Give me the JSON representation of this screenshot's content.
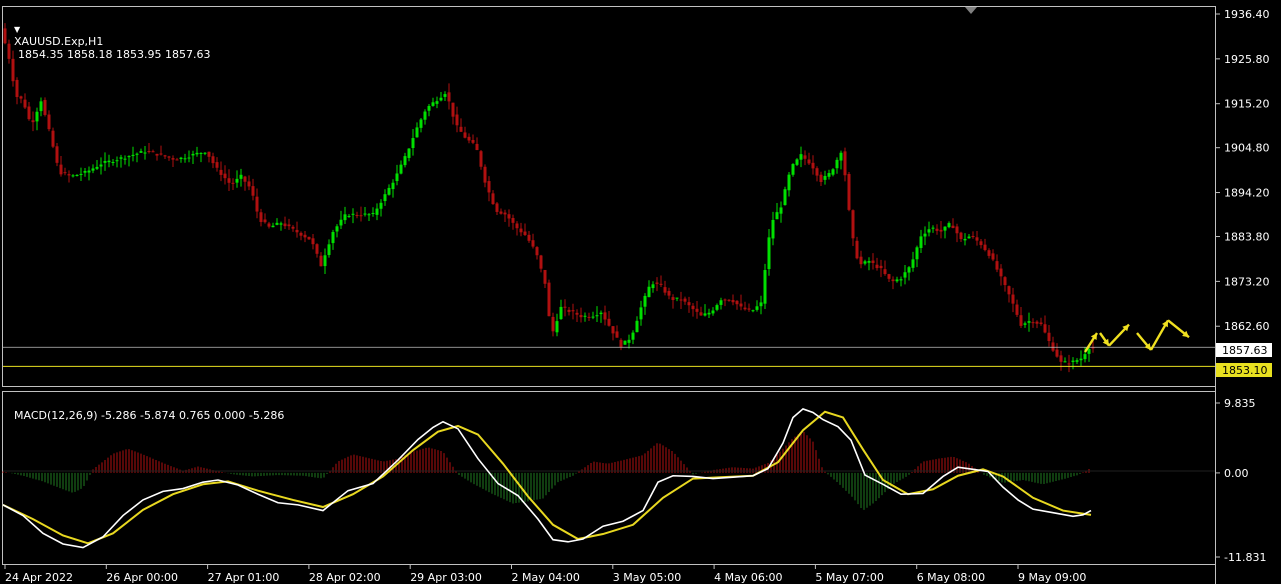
{
  "header": {
    "symbol": "XAUUSD.Exp,H1",
    "ohlc": "1854.35 1858.18 1853.95 1857.63"
  },
  "macd_header": {
    "label": "MACD(12,26,9) -5.286 -5.874 0.765 0.000 -5.286"
  },
  "colors": {
    "background": "#000000",
    "bull": "#00e000",
    "bear": "#b01010",
    "axis": "#c0c0c0",
    "macd_line": "#ffffff",
    "signal_line": "#e8d820",
    "price_line": "#c0c0c0",
    "level_line": "#e8e020",
    "arrow": "#f0e020"
  },
  "chart_data": [
    {
      "type": "candlestick",
      "title": "XAUUSD.Exp,H1",
      "ylim": [
        1850.6,
        1936.4
      ],
      "y_ticks": [
        "1936.40",
        "1925.80",
        "1915.20",
        "1904.80",
        "1894.20",
        "1883.80",
        "1873.20",
        "1862.60"
      ],
      "x_ticks": [
        "24 Apr 2022",
        "26 Apr 00:00",
        "27 Apr 01:00",
        "28 Apr 02:00",
        "29 Apr 03:00",
        "2 May 04:00",
        "3 May 05:00",
        "4 May 06:00",
        "5 May 07:00",
        "6 May 08:00",
        "9 May 09:00"
      ],
      "current_price": 1857.63,
      "current_price_label": "1857.63",
      "level": 1853.1,
      "level_label": "1853.10",
      "price_path": [
        [
          0,
          1933
        ],
        [
          8,
          1926
        ],
        [
          15,
          1917
        ],
        [
          22,
          1916
        ],
        [
          30,
          1910
        ],
        [
          40,
          1916
        ],
        [
          50,
          1907
        ],
        [
          58,
          1899
        ],
        [
          70,
          1898
        ],
        [
          85,
          1899
        ],
        [
          100,
          1901
        ],
        [
          115,
          1902
        ],
        [
          130,
          1903
        ],
        [
          145,
          1904
        ],
        [
          160,
          1903
        ],
        [
          175,
          1902
        ],
        [
          190,
          1903
        ],
        [
          205,
          1904
        ],
        [
          215,
          1900
        ],
        [
          230,
          1896
        ],
        [
          240,
          1898
        ],
        [
          250,
          1895
        ],
        [
          258,
          1888
        ],
        [
          268,
          1886
        ],
        [
          280,
          1887
        ],
        [
          295,
          1885
        ],
        [
          310,
          1883
        ],
        [
          320,
          1877
        ],
        [
          332,
          1885
        ],
        [
          345,
          1889
        ],
        [
          360,
          1889
        ],
        [
          372,
          1889
        ],
        [
          385,
          1894
        ],
        [
          395,
          1898
        ],
        [
          405,
          1903
        ],
        [
          415,
          1909
        ],
        [
          425,
          1914
        ],
        [
          435,
          1916
        ],
        [
          445,
          1918
        ],
        [
          455,
          1910
        ],
        [
          465,
          1907
        ],
        [
          475,
          1905
        ],
        [
          485,
          1896
        ],
        [
          495,
          1890
        ],
        [
          505,
          1889
        ],
        [
          515,
          1886
        ],
        [
          525,
          1884
        ],
        [
          535,
          1880
        ],
        [
          545,
          1872
        ],
        [
          550,
          1860
        ],
        [
          560,
          1867
        ],
        [
          570,
          1866
        ],
        [
          580,
          1865
        ],
        [
          590,
          1865
        ],
        [
          600,
          1866
        ],
        [
          610,
          1862
        ],
        [
          620,
          1858
        ],
        [
          630,
          1860
        ],
        [
          640,
          1867
        ],
        [
          650,
          1873
        ],
        [
          660,
          1872
        ],
        [
          670,
          1869
        ],
        [
          680,
          1869
        ],
        [
          690,
          1867
        ],
        [
          700,
          1865
        ],
        [
          710,
          1866
        ],
        [
          720,
          1869
        ],
        [
          730,
          1869
        ],
        [
          740,
          1867
        ],
        [
          750,
          1866
        ],
        [
          760,
          1868
        ],
        [
          765,
          1878
        ],
        [
          770,
          1887
        ],
        [
          780,
          1891
        ],
        [
          790,
          1900
        ],
        [
          800,
          1903
        ],
        [
          810,
          1901
        ],
        [
          820,
          1897
        ],
        [
          830,
          1899
        ],
        [
          840,
          1904
        ],
        [
          845,
          1897
        ],
        [
          850,
          1885
        ],
        [
          858,
          1877
        ],
        [
          868,
          1878
        ],
        [
          880,
          1876
        ],
        [
          890,
          1873
        ],
        [
          900,
          1874
        ],
        [
          910,
          1877
        ],
        [
          920,
          1884
        ],
        [
          930,
          1886
        ],
        [
          940,
          1885
        ],
        [
          950,
          1887
        ],
        [
          960,
          1883
        ],
        [
          970,
          1884
        ],
        [
          980,
          1882
        ],
        [
          990,
          1879
        ],
        [
          1000,
          1874
        ],
        [
          1010,
          1869
        ],
        [
          1020,
          1863
        ],
        [
          1030,
          1864
        ],
        [
          1040,
          1863
        ],
        [
          1050,
          1858
        ],
        [
          1060,
          1854
        ],
        [
          1070,
          1854
        ],
        [
          1080,
          1855
        ],
        [
          1088,
          1857.6
        ]
      ],
      "forecast_arrows": [
        [
          [
            1082,
            1856.5
          ],
          [
            1094,
            1861
          ]
        ],
        [
          [
            1097,
            1861
          ],
          [
            1106,
            1858
          ]
        ],
        [
          [
            1106,
            1858
          ],
          [
            1126,
            1863
          ]
        ],
        [
          [
            1134,
            1861
          ],
          [
            1148,
            1857
          ]
        ],
        [
          [
            1148,
            1857
          ],
          [
            1165,
            1864
          ]
        ],
        [
          [
            1165,
            1864
          ],
          [
            1186,
            1860
          ]
        ]
      ]
    },
    {
      "type": "line",
      "title": "MACD(12,26,9)",
      "ylim": [
        -11.831,
        9.835
      ],
      "y_ticks": [
        "9.835",
        "0.00",
        "-11.831"
      ],
      "values_label": "-5.286 -5.874 0.765 0.000 -5.286",
      "macd": [
        [
          0,
          -4.5
        ],
        [
          20,
          -6
        ],
        [
          40,
          -8.5
        ],
        [
          60,
          -10
        ],
        [
          80,
          -10.5
        ],
        [
          100,
          -9
        ],
        [
          120,
          -6
        ],
        [
          140,
          -3.8
        ],
        [
          160,
          -2.6
        ],
        [
          180,
          -2.2
        ],
        [
          200,
          -1.3
        ],
        [
          215,
          -1.0
        ],
        [
          235,
          -1.7
        ],
        [
          255,
          -3
        ],
        [
          275,
          -4.2
        ],
        [
          295,
          -4.5
        ],
        [
          320,
          -5.3
        ],
        [
          345,
          -2.5
        ],
        [
          370,
          -1.5
        ],
        [
          395,
          1.8
        ],
        [
          415,
          4.7
        ],
        [
          430,
          6.4
        ],
        [
          440,
          7.2
        ],
        [
          455,
          6.2
        ],
        [
          475,
          2.0
        ],
        [
          495,
          -1.5
        ],
        [
          515,
          -3.2
        ],
        [
          535,
          -6.5
        ],
        [
          550,
          -9.4
        ],
        [
          565,
          -9.7
        ],
        [
          580,
          -9.3
        ],
        [
          600,
          -7.5
        ],
        [
          620,
          -6.8
        ],
        [
          640,
          -5.3
        ],
        [
          655,
          -1.3
        ],
        [
          670,
          -0.4
        ],
        [
          690,
          -0.5
        ],
        [
          710,
          -0.8
        ],
        [
          730,
          -0.6
        ],
        [
          750,
          -0.4
        ],
        [
          765,
          0.6
        ],
        [
          780,
          4.2
        ],
        [
          790,
          7.8
        ],
        [
          800,
          9.0
        ],
        [
          810,
          8.5
        ],
        [
          820,
          7.5
        ],
        [
          835,
          6.5
        ],
        [
          848,
          4.6
        ],
        [
          862,
          -0.3
        ],
        [
          880,
          -1.6
        ],
        [
          898,
          -3.0
        ],
        [
          920,
          -2.9
        ],
        [
          940,
          -0.5
        ],
        [
          955,
          0.8
        ],
        [
          970,
          0.5
        ],
        [
          985,
          0.2
        ],
        [
          1000,
          -2.0
        ],
        [
          1015,
          -3.8
        ],
        [
          1030,
          -5.1
        ],
        [
          1050,
          -5.6
        ],
        [
          1070,
          -6.1
        ],
        [
          1080,
          -5.9
        ],
        [
          1088,
          -5.3
        ]
      ],
      "signal": [
        [
          0,
          -4.5
        ],
        [
          30,
          -6.5
        ],
        [
          60,
          -8.8
        ],
        [
          85,
          -9.9
        ],
        [
          110,
          -8.5
        ],
        [
          140,
          -5.2
        ],
        [
          170,
          -3
        ],
        [
          200,
          -1.6
        ],
        [
          225,
          -1.2
        ],
        [
          255,
          -2.5
        ],
        [
          290,
          -3.8
        ],
        [
          320,
          -4.8
        ],
        [
          350,
          -3
        ],
        [
          380,
          -0.5
        ],
        [
          410,
          3.2
        ],
        [
          435,
          5.8
        ],
        [
          455,
          6.6
        ],
        [
          475,
          5.4
        ],
        [
          500,
          1.3
        ],
        [
          525,
          -3.3
        ],
        [
          550,
          -7.3
        ],
        [
          575,
          -9.3
        ],
        [
          600,
          -8.6
        ],
        [
          630,
          -7.3
        ],
        [
          660,
          -3.5
        ],
        [
          690,
          -0.8
        ],
        [
          720,
          -0.6
        ],
        [
          750,
          -0.4
        ],
        [
          775,
          1.5
        ],
        [
          800,
          6.0
        ],
        [
          822,
          8.6
        ],
        [
          840,
          7.8
        ],
        [
          860,
          3.3
        ],
        [
          880,
          -1.0
        ],
        [
          905,
          -3.0
        ],
        [
          930,
          -2.3
        ],
        [
          955,
          -0.4
        ],
        [
          980,
          0.5
        ],
        [
          1000,
          -0.5
        ],
        [
          1030,
          -3.5
        ],
        [
          1060,
          -5.3
        ],
        [
          1088,
          -5.9
        ]
      ],
      "histogram": [
        [
          0,
          0.2
        ],
        [
          20,
          -0.4
        ],
        [
          40,
          -1.2
        ],
        [
          60,
          -2.3
        ],
        [
          70,
          -2.8
        ],
        [
          80,
          -2.1
        ],
        [
          90,
          0.5
        ],
        [
          110,
          2.7
        ],
        [
          125,
          3.4
        ],
        [
          140,
          2.6
        ],
        [
          160,
          1.4
        ],
        [
          180,
          0.3
        ],
        [
          195,
          0.9
        ],
        [
          210,
          0.4
        ],
        [
          230,
          -0.2
        ],
        [
          250,
          -0.5
        ],
        [
          275,
          -0.3
        ],
        [
          300,
          -0.4
        ],
        [
          320,
          -0.8
        ],
        [
          335,
          1.6
        ],
        [
          350,
          2.6
        ],
        [
          365,
          2.1
        ],
        [
          380,
          1.6
        ],
        [
          395,
          2.0
        ],
        [
          410,
          3.0
        ],
        [
          425,
          3.6
        ],
        [
          440,
          3.0
        ],
        [
          455,
          -0.2
        ],
        [
          470,
          -1.5
        ],
        [
          490,
          -3.0
        ],
        [
          510,
          -4.3
        ],
        [
          525,
          -4.0
        ],
        [
          540,
          -3.6
        ],
        [
          555,
          -1.3
        ],
        [
          570,
          -0.4
        ],
        [
          590,
          1.6
        ],
        [
          605,
          1.3
        ],
        [
          620,
          1.8
        ],
        [
          640,
          2.5
        ],
        [
          655,
          4.3
        ],
        [
          670,
          3.0
        ],
        [
          690,
          -0.2
        ],
        [
          710,
          0.4
        ],
        [
          730,
          0.8
        ],
        [
          750,
          0.6
        ],
        [
          765,
          1.4
        ],
        [
          780,
          3.4
        ],
        [
          790,
          4.9
        ],
        [
          800,
          5.9
        ],
        [
          810,
          4.4
        ],
        [
          820,
          0.4
        ],
        [
          835,
          -1.4
        ],
        [
          850,
          -3.5
        ],
        [
          860,
          -5.3
        ],
        [
          872,
          -4.1
        ],
        [
          890,
          -1.6
        ],
        [
          905,
          -0.4
        ],
        [
          920,
          1.6
        ],
        [
          935,
          2.0
        ],
        [
          950,
          2.3
        ],
        [
          965,
          1.4
        ],
        [
          980,
          -0.2
        ],
        [
          1000,
          -1.4
        ],
        [
          1020,
          -1.0
        ],
        [
          1040,
          -1.6
        ],
        [
          1060,
          -0.9
        ],
        [
          1075,
          -0.3
        ],
        [
          1088,
          0.7
        ]
      ]
    }
  ]
}
